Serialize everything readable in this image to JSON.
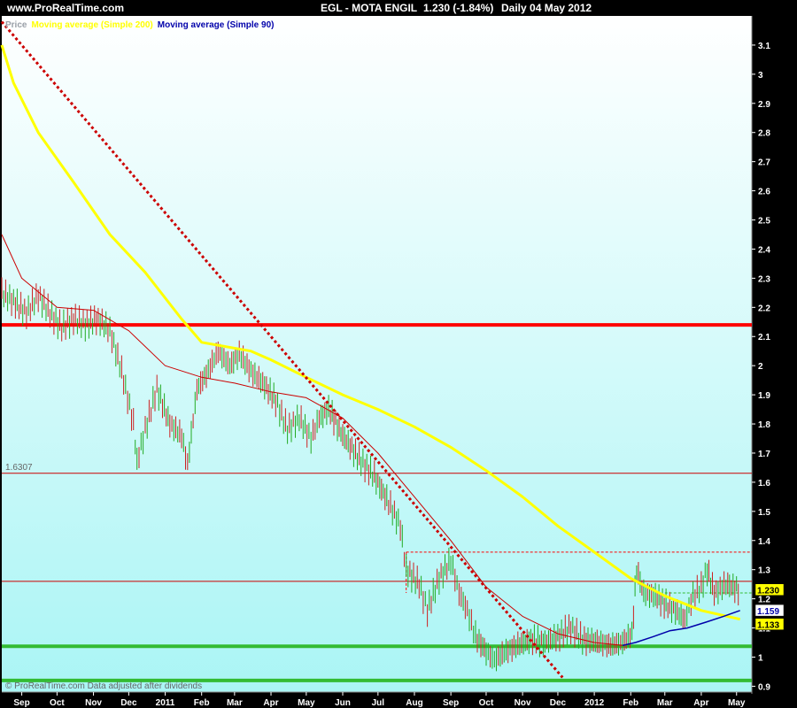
{
  "header": {
    "site": "www.ProRealTime.com",
    "symbol": "EGL - MOTA ENGIL",
    "quote": "1.230 (-1.84%)",
    "period": "Daily  04 May 2012"
  },
  "legend": [
    {
      "label": "Price",
      "color": "#9aa0a8"
    },
    {
      "label": "Moving average (Simple 200)",
      "color": "#ffff00"
    },
    {
      "label": "Moving average (Simple 90)",
      "color": "#0000aa"
    }
  ],
  "footer": {
    "text": "© ProRealTime.com  Data adjusted after dividends"
  },
  "colors": {
    "bg_top": "#ffffff",
    "bg_bottom": "#aaf5f5",
    "price_up": "#22aa22",
    "price_down": "#cc2222",
    "sma200": "#ffff00",
    "sma90": "#0000aa",
    "ma_red": "#cc0000",
    "level": "#ff0000",
    "support": "#33bb33",
    "trend": "#cc0000"
  },
  "chart_data": {
    "type": "line",
    "xlabel": "",
    "ylabel": "",
    "x_range": [
      "2010-08-15",
      "2012-05-14"
    ],
    "ylim": [
      0.88,
      3.2
    ],
    "yticks": [
      0.9,
      1,
      1.1,
      1.2,
      1.3,
      1.4,
      1.5,
      1.6,
      1.7,
      1.8,
      1.9,
      2,
      2.1,
      2.2,
      2.3,
      2.4,
      2.5,
      2.6,
      2.7,
      2.8,
      2.9,
      3,
      3.1
    ],
    "xticks": [
      {
        "label": "Sep",
        "date": "2010-09-01"
      },
      {
        "label": "Oct",
        "date": "2010-10-01"
      },
      {
        "label": "Nov",
        "date": "2010-11-01"
      },
      {
        "label": "Dec",
        "date": "2010-12-01"
      },
      {
        "label": "2011",
        "date": "2011-01-01"
      },
      {
        "label": "Feb",
        "date": "2011-02-01"
      },
      {
        "label": "Mar",
        "date": "2011-03-01"
      },
      {
        "label": "Apr",
        "date": "2011-04-01"
      },
      {
        "label": "May",
        "date": "2011-05-01"
      },
      {
        "label": "Jun",
        "date": "2011-06-01"
      },
      {
        "label": "Jul",
        "date": "2011-07-01"
      },
      {
        "label": "Aug",
        "date": "2011-08-01"
      },
      {
        "label": "Sep",
        "date": "2011-09-01"
      },
      {
        "label": "Oct",
        "date": "2011-10-01"
      },
      {
        "label": "Nov",
        "date": "2011-11-01"
      },
      {
        "label": "Dec",
        "date": "2011-12-01"
      },
      {
        "label": "2012",
        "date": "2012-01-01"
      },
      {
        "label": "Feb",
        "date": "2012-02-01"
      },
      {
        "label": "Mar",
        "date": "2012-03-01"
      },
      {
        "label": "Apr",
        "date": "2012-04-01"
      },
      {
        "label": "May",
        "date": "2012-05-01"
      }
    ],
    "series": [
      {
        "name": "Price",
        "points": [
          [
            "2010-08-15",
            2.25
          ],
          [
            "2010-08-25",
            2.22
          ],
          [
            "2010-09-05",
            2.18
          ],
          [
            "2010-09-15",
            2.24
          ],
          [
            "2010-09-25",
            2.18
          ],
          [
            "2010-10-05",
            2.13
          ],
          [
            "2010-10-15",
            2.16
          ],
          [
            "2010-10-25",
            2.14
          ],
          [
            "2010-11-05",
            2.16
          ],
          [
            "2010-11-15",
            2.12
          ],
          [
            "2010-11-25",
            1.98
          ],
          [
            "2010-12-05",
            1.8
          ],
          [
            "2010-12-08",
            1.67
          ],
          [
            "2010-12-15",
            1.78
          ],
          [
            "2010-12-25",
            1.92
          ],
          [
            "2011-01-05",
            1.8
          ],
          [
            "2011-01-15",
            1.76
          ],
          [
            "2011-01-20",
            1.66
          ],
          [
            "2011-01-28",
            1.92
          ],
          [
            "2011-02-05",
            1.97
          ],
          [
            "2011-02-15",
            2.05
          ],
          [
            "2011-02-25",
            2.0
          ],
          [
            "2011-03-05",
            2.04
          ],
          [
            "2011-03-15",
            1.98
          ],
          [
            "2011-03-25",
            1.94
          ],
          [
            "2011-04-05",
            1.88
          ],
          [
            "2011-04-15",
            1.78
          ],
          [
            "2011-04-25",
            1.82
          ],
          [
            "2011-05-05",
            1.75
          ],
          [
            "2011-05-12",
            1.82
          ],
          [
            "2011-05-20",
            1.85
          ],
          [
            "2011-06-01",
            1.76
          ],
          [
            "2011-06-15",
            1.68
          ],
          [
            "2011-06-28",
            1.62
          ],
          [
            "2011-07-10",
            1.53
          ],
          [
            "2011-07-20",
            1.45
          ],
          [
            "2011-07-25",
            1.3
          ],
          [
            "2011-08-05",
            1.25
          ],
          [
            "2011-08-12",
            1.16
          ],
          [
            "2011-08-22",
            1.27
          ],
          [
            "2011-09-01",
            1.33
          ],
          [
            "2011-09-08",
            1.22
          ],
          [
            "2011-09-15",
            1.16
          ],
          [
            "2011-09-22",
            1.07
          ],
          [
            "2011-10-01",
            1.02
          ],
          [
            "2011-10-08",
            0.99
          ],
          [
            "2011-10-18",
            1.02
          ],
          [
            "2011-10-28",
            1.04
          ],
          [
            "2011-11-08",
            1.06
          ],
          [
            "2011-11-20",
            1.05
          ],
          [
            "2011-12-01",
            1.07
          ],
          [
            "2011-12-12",
            1.1
          ],
          [
            "2011-12-22",
            1.06
          ],
          [
            "2012-01-05",
            1.05
          ],
          [
            "2012-01-15",
            1.04
          ],
          [
            "2012-01-25",
            1.05
          ],
          [
            "2012-02-02",
            1.08
          ],
          [
            "2012-02-06",
            1.3
          ],
          [
            "2012-02-12",
            1.22
          ],
          [
            "2012-02-22",
            1.21
          ],
          [
            "2012-03-02",
            1.18
          ],
          [
            "2012-03-10",
            1.16
          ],
          [
            "2012-03-18",
            1.13
          ],
          [
            "2012-03-25",
            1.21
          ],
          [
            "2012-04-01",
            1.24
          ],
          [
            "2012-04-06",
            1.3
          ],
          [
            "2012-04-12",
            1.22
          ],
          [
            "2012-04-22",
            1.25
          ],
          [
            "2012-05-04",
            1.23
          ]
        ]
      },
      {
        "name": "Moving average (Simple 200)",
        "points": [
          [
            "2010-08-15",
            3.1
          ],
          [
            "2010-08-25",
            2.97
          ],
          [
            "2010-09-15",
            2.8
          ],
          [
            "2010-10-15",
            2.63
          ],
          [
            "2010-11-15",
            2.45
          ],
          [
            "2010-12-15",
            2.32
          ],
          [
            "2011-01-15",
            2.16
          ],
          [
            "2011-02-01",
            2.08
          ],
          [
            "2011-02-15",
            2.07
          ],
          [
            "2011-03-15",
            2.05
          ],
          [
            "2011-04-01",
            2.02
          ],
          [
            "2011-05-01",
            1.96
          ],
          [
            "2011-06-01",
            1.9
          ],
          [
            "2011-07-01",
            1.85
          ],
          [
            "2011-08-01",
            1.79
          ],
          [
            "2011-09-01",
            1.72
          ],
          [
            "2011-10-01",
            1.64
          ],
          [
            "2011-11-01",
            1.55
          ],
          [
            "2011-12-01",
            1.45
          ],
          [
            "2012-01-01",
            1.36
          ],
          [
            "2012-02-01",
            1.27
          ],
          [
            "2012-03-01",
            1.21
          ],
          [
            "2012-04-01",
            1.16
          ],
          [
            "2012-05-04",
            1.13
          ]
        ]
      },
      {
        "name": "Moving average (Simple 90)",
        "points": [
          [
            "2012-01-25",
            1.04
          ],
          [
            "2012-02-05",
            1.05
          ],
          [
            "2012-02-20",
            1.07
          ],
          [
            "2012-03-05",
            1.09
          ],
          [
            "2012-03-20",
            1.1
          ],
          [
            "2012-04-05",
            1.12
          ],
          [
            "2012-04-20",
            1.14
          ],
          [
            "2012-05-04",
            1.16
          ]
        ]
      },
      {
        "points": [
          [
            "2010-08-15",
            2.45
          ],
          [
            "2010-09-01",
            2.3
          ],
          [
            "2010-10-01",
            2.2
          ],
          [
            "2010-11-01",
            2.19
          ],
          [
            "2010-12-01",
            2.12
          ],
          [
            "2011-01-01",
            2.0
          ],
          [
            "2011-02-01",
            1.96
          ],
          [
            "2011-03-01",
            1.94
          ],
          [
            "2011-04-01",
            1.91
          ],
          [
            "2011-05-01",
            1.89
          ],
          [
            "2011-06-01",
            1.82
          ],
          [
            "2011-07-01",
            1.7
          ],
          [
            "2011-08-01",
            1.55
          ],
          [
            "2011-09-01",
            1.4
          ],
          [
            "2011-10-01",
            1.24
          ],
          [
            "2011-11-01",
            1.14
          ],
          [
            "2011-12-01",
            1.08
          ],
          [
            "2012-01-01",
            1.05
          ],
          [
            "2012-01-25",
            1.04
          ]
        ]
      }
    ],
    "horizontal_lines": [
      {
        "value": 2.14,
        "style": "thick",
        "color": "#ff0000"
      },
      {
        "value": 1.6307,
        "label": "1.6307",
        "style": "thin",
        "color": "#cc0000"
      },
      {
        "value": 1.26,
        "style": "thin",
        "color": "#cc0000"
      },
      {
        "value": 1.037,
        "style": "thick",
        "color": "#33bb33"
      },
      {
        "value": 0.92,
        "style": "thick",
        "color": "#33bb33"
      }
    ],
    "box": {
      "x0": "2011-07-25",
      "x1": "2012-05-14",
      "y_top": 1.36,
      "y_mid": 1.22
    },
    "trendline": [
      [
        "2010-08-15",
        3.18
      ],
      [
        "2011-12-05",
        0.93
      ]
    ],
    "price_tags": [
      {
        "label": "1.230",
        "value": 1.23,
        "bg": "#ffff00",
        "fg": "#000000"
      },
      {
        "label": "1.159",
        "value": 1.159,
        "bg": "#ffffff",
        "fg": "#0000aa"
      },
      {
        "label": "1.133",
        "value": 1.13,
        "bg": "#ffff00",
        "fg": "#000000"
      }
    ]
  }
}
